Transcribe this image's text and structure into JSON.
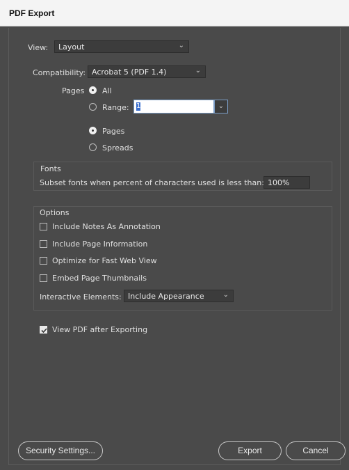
{
  "window": {
    "title": "PDF Export"
  },
  "view": {
    "label": "View:",
    "value": "Layout"
  },
  "compatibility": {
    "label": "Compatibility:",
    "value": "Acrobat 5 (PDF 1.4)"
  },
  "pages": {
    "label": "Pages",
    "all_label": "All",
    "range_label": "Range:",
    "range_value": "1",
    "pages_label": "Pages",
    "spreads_label": "Spreads"
  },
  "fonts": {
    "heading": "Fonts",
    "subset_label": "Subset fonts when percent of characters used is less than:",
    "subset_value": "100%"
  },
  "options": {
    "heading": "Options",
    "items": [
      {
        "label": "Include Notes As Annotation",
        "checked": false
      },
      {
        "label": "Include Page Information",
        "checked": false
      },
      {
        "label": "Optimize for Fast Web View",
        "checked": false
      },
      {
        "label": "Embed Page Thumbnails",
        "checked": false
      }
    ],
    "interactive_label": "Interactive Elements:",
    "interactive_value": "Include Appearance"
  },
  "view_after": {
    "label": "View PDF after Exporting",
    "checked": true
  },
  "buttons": {
    "security": "Security Settings...",
    "export": "Export",
    "cancel": "Cancel"
  },
  "icons": {
    "dropdown": "chevron-down-icon",
    "check": "checkmark-icon"
  }
}
